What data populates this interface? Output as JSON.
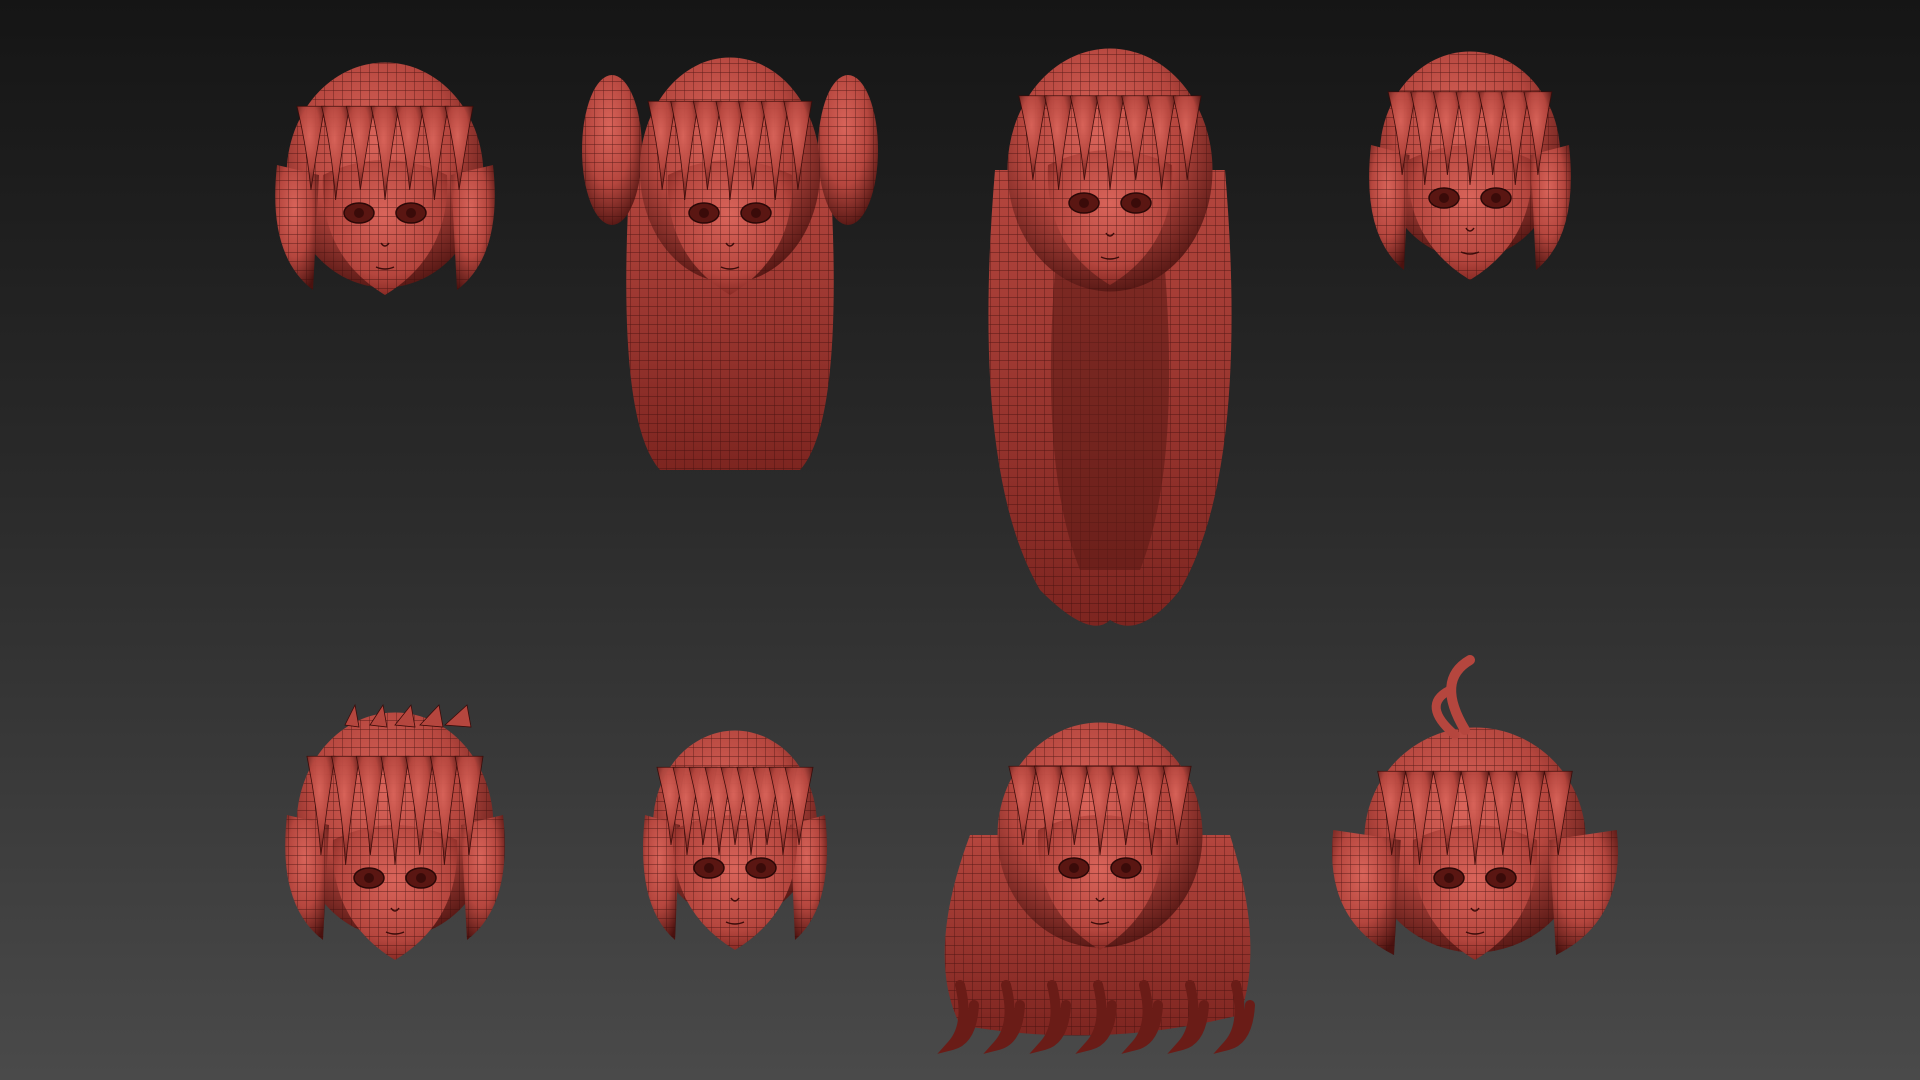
{
  "viewport": {
    "background_top": "#151515",
    "background_mid": "#2a2a2a",
    "background_bottom": "#4a4a4a"
  },
  "material": {
    "base_color": "#b5463e",
    "shadow_color": "#4a120f",
    "highlight_color": "#d9645a",
    "wire_color": "#3a0c0a"
  },
  "heads": [
    {
      "id": "head-short-bob-with-side-braid",
      "row": 1,
      "col": 1,
      "style": "short-bob"
    },
    {
      "id": "head-long-hair-with-ear-buns",
      "row": 1,
      "col": 2,
      "style": "long-buns"
    },
    {
      "id": "head-very-long-flowing-hair",
      "row": 1,
      "col": 3,
      "style": "very-long"
    },
    {
      "id": "head-short-boyish-hair",
      "row": 1,
      "col": 4,
      "style": "short-boy"
    },
    {
      "id": "head-messy-spiky-bob",
      "row": 2,
      "col": 1,
      "style": "spiky-bob"
    },
    {
      "id": "head-round-bowl-cut",
      "row": 2,
      "col": 2,
      "style": "bowl"
    },
    {
      "id": "head-wavy-medium-hair",
      "row": 2,
      "col": 3,
      "style": "wavy"
    },
    {
      "id": "head-bob-with-ahoge",
      "row": 2,
      "col": 4,
      "style": "ahoge-bob"
    }
  ]
}
